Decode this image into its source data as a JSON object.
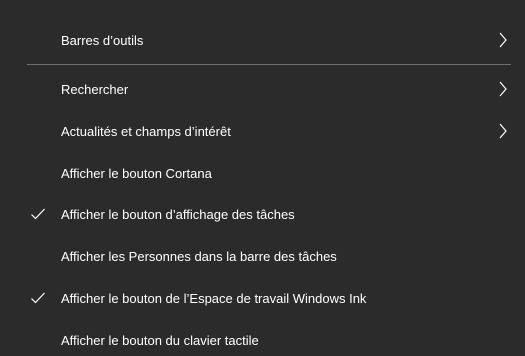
{
  "colors": {
    "background": "#2b2b2b",
    "text": "#ffffff",
    "separator": "#6e6e6e"
  },
  "menu": {
    "items": [
      {
        "label": "Barres d’outils",
        "submenu": true,
        "checked": false
      },
      {
        "label": "Rechercher",
        "submenu": true,
        "checked": false
      },
      {
        "label": "Actualités et champs d’intérêt",
        "submenu": true,
        "checked": false
      },
      {
        "label": "Afficher le bouton Cortana",
        "submenu": false,
        "checked": false
      },
      {
        "label": "Afficher le bouton d’affichage des tâches",
        "submenu": false,
        "checked": true
      },
      {
        "label": "Afficher les Personnes dans la barre des tâches",
        "submenu": false,
        "checked": false
      },
      {
        "label": "Afficher le bouton de l’Espace de travail Windows Ink",
        "submenu": false,
        "checked": true
      },
      {
        "label": "Afficher le bouton du clavier tactile",
        "submenu": false,
        "checked": false
      }
    ]
  }
}
